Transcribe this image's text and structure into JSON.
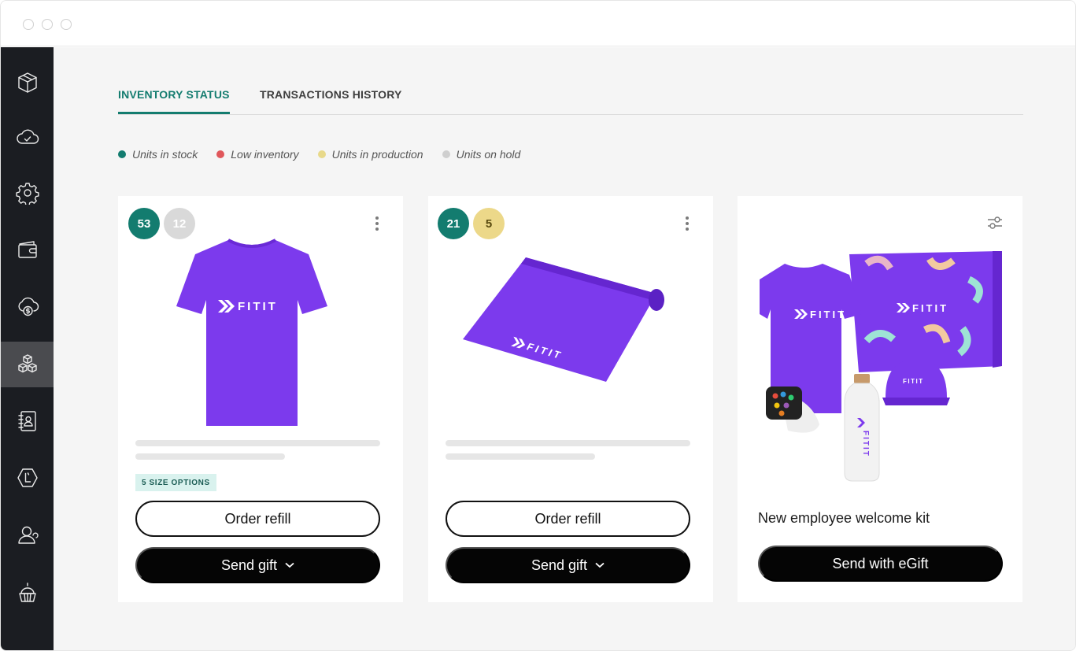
{
  "window": {
    "controls": [
      "close",
      "minimize",
      "maximize"
    ]
  },
  "sidebar": {
    "items": [
      {
        "icon": "box-icon",
        "active": false
      },
      {
        "icon": "cloud-check-icon",
        "active": false
      },
      {
        "icon": "gear-icon",
        "active": false
      },
      {
        "icon": "wallet-icon",
        "active": false
      },
      {
        "icon": "cloud-dollar-icon",
        "active": false
      },
      {
        "icon": "boxes-stack-icon",
        "active": true
      },
      {
        "icon": "contact-book-icon",
        "active": false
      },
      {
        "icon": "hexagon-badge-icon",
        "active": false
      },
      {
        "icon": "user-icon",
        "active": false
      },
      {
        "icon": "cupcake-icon",
        "active": false
      }
    ]
  },
  "tabs": [
    {
      "label": "INVENTORY STATUS",
      "active": true
    },
    {
      "label": "TRANSACTIONS HISTORY",
      "active": false
    }
  ],
  "legend": [
    {
      "label": "Units in stock",
      "color": "#137c6f"
    },
    {
      "label": "Low inventory",
      "color": "#e0575b"
    },
    {
      "label": "Units in production",
      "color": "#e8d98a"
    },
    {
      "label": "Units on hold",
      "color": "#cfcfcf"
    }
  ],
  "cards": [
    {
      "product": "t-shirt",
      "badges": [
        {
          "value": "53",
          "bg": "#137c6f",
          "fg": "#ffffff"
        },
        {
          "value": "12",
          "bg": "#d9d9d9",
          "fg": "#ffffff"
        }
      ],
      "brand_text": "FITIT",
      "tag": "5 SIZE OPTIONS",
      "order_label": "Order refill",
      "send_label": "Send gift"
    },
    {
      "product": "yoga-mat",
      "badges": [
        {
          "value": "21",
          "bg": "#137c6f",
          "fg": "#ffffff"
        },
        {
          "value": "5",
          "bg": "#ecd889",
          "fg": "#5a4b10"
        }
      ],
      "brand_text": "FITIT",
      "order_label": "Order refill",
      "send_label": "Send gift"
    },
    {
      "product": "welcome-kit",
      "brand_text": "FITIT",
      "title": "New employee welcome kit",
      "send_label": "Send with eGift"
    }
  ],
  "colors": {
    "brand_purple": "#7c3aed",
    "accent_teal": "#137c6f",
    "dark_button": "#050505"
  }
}
